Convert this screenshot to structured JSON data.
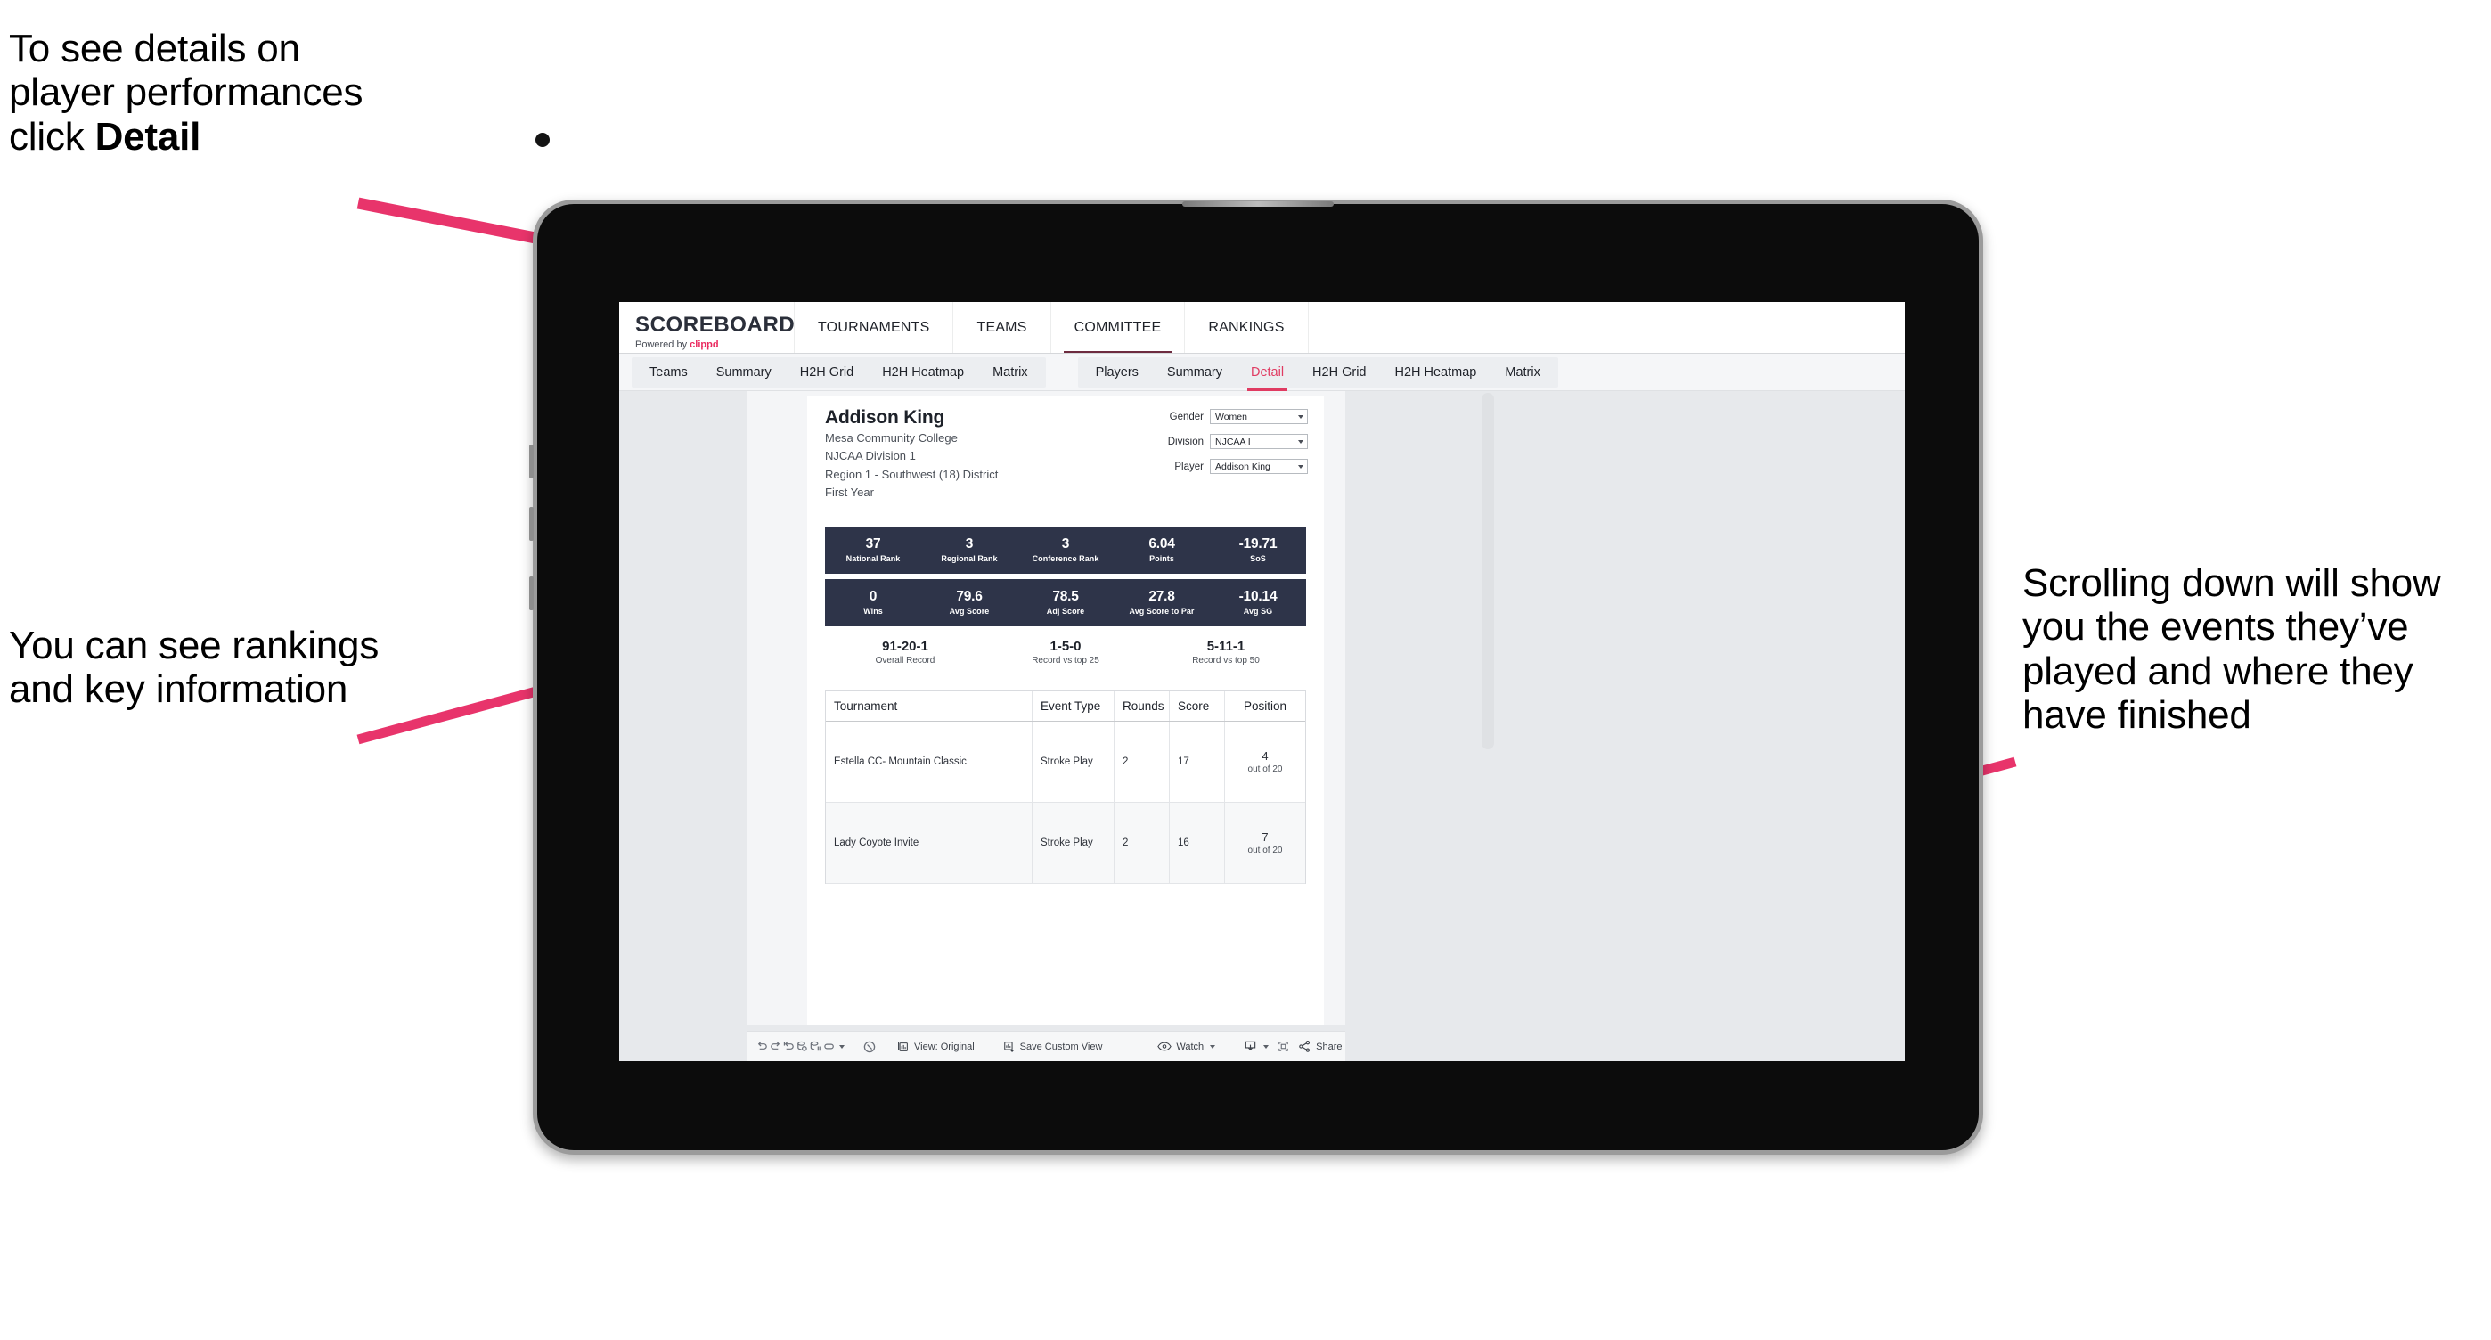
{
  "annotations": {
    "top_left_line1": "To see details on",
    "top_left_line2": "player performances",
    "top_left_line3_prefix": "click ",
    "top_left_line3_bold": "Detail",
    "mid_left": "You can see rankings and key information",
    "right": "Scrolling down will show you the events they’ve played and where they have finished"
  },
  "app": {
    "brand_title": "SCOREBOARD",
    "brand_powered_prefix": "Powered by ",
    "brand_powered_name": "clippd",
    "top_nav": [
      {
        "label": "TOURNAMENTS",
        "active": false
      },
      {
        "label": "TEAMS",
        "active": false
      },
      {
        "label": "COMMITTEE",
        "active": true
      },
      {
        "label": "RANKINGS",
        "active": false
      }
    ],
    "sub_nav_group_1": [
      {
        "label": "Teams",
        "active": false
      },
      {
        "label": "Summary",
        "active": false
      },
      {
        "label": "H2H Grid",
        "active": false
      },
      {
        "label": "H2H Heatmap",
        "active": false
      },
      {
        "label": "Matrix",
        "active": false
      }
    ],
    "sub_nav_group_2": [
      {
        "label": "Players",
        "active": false
      },
      {
        "label": "Summary",
        "active": false
      },
      {
        "label": "Detail",
        "active": true
      },
      {
        "label": "H2H Grid",
        "active": false
      },
      {
        "label": "H2H Heatmap",
        "active": false
      },
      {
        "label": "Matrix",
        "active": false
      }
    ],
    "accent_color": "#e03b62",
    "navy_color": "#2e3449"
  },
  "player": {
    "name": "Addison King",
    "school": "Mesa Community College",
    "division": "NJCAA Division 1",
    "region": "Region 1 - Southwest (18) District",
    "class_year": "First Year"
  },
  "filters": [
    {
      "label": "Gender",
      "value": "Women"
    },
    {
      "label": "Division",
      "value": "NJCAA I"
    },
    {
      "label": "Player",
      "value": "Addison King"
    }
  ],
  "stats_row_1": [
    {
      "value": "37",
      "label": "National Rank"
    },
    {
      "value": "3",
      "label": "Regional Rank"
    },
    {
      "value": "3",
      "label": "Conference Rank"
    },
    {
      "value": "6.04",
      "label": "Points"
    },
    {
      "value": "-19.71",
      "label": "SoS"
    }
  ],
  "stats_row_2": [
    {
      "value": "0",
      "label": "Wins"
    },
    {
      "value": "79.6",
      "label": "Avg Score"
    },
    {
      "value": "78.5",
      "label": "Adj Score"
    },
    {
      "value": "27.8",
      "label": "Avg Score to Par"
    },
    {
      "value": "-10.14",
      "label": "Avg SG"
    }
  ],
  "records": [
    {
      "value": "91-20-1",
      "label": "Overall Record"
    },
    {
      "value": "1-5-0",
      "label": "Record vs top 25"
    },
    {
      "value": "5-11-1",
      "label": "Record vs top 50"
    }
  ],
  "tournament_table": {
    "columns": [
      "Tournament",
      "Event Type",
      "Rounds",
      "Score",
      "Position"
    ],
    "rows": [
      {
        "tournament": "Estella CC- Mountain Classic",
        "event_type": "Stroke Play",
        "rounds": "2",
        "score": "17",
        "position": "4",
        "position_sub": "out of 20"
      },
      {
        "tournament": "Lady Coyote Invite",
        "event_type": "Stroke Play",
        "rounds": "2",
        "score": "16",
        "position": "7",
        "position_sub": "out of 20"
      }
    ]
  },
  "toolbar": {
    "view_label": "View: Original",
    "save_label": "Save Custom View",
    "watch_label": "Watch",
    "share_label": "Share"
  }
}
